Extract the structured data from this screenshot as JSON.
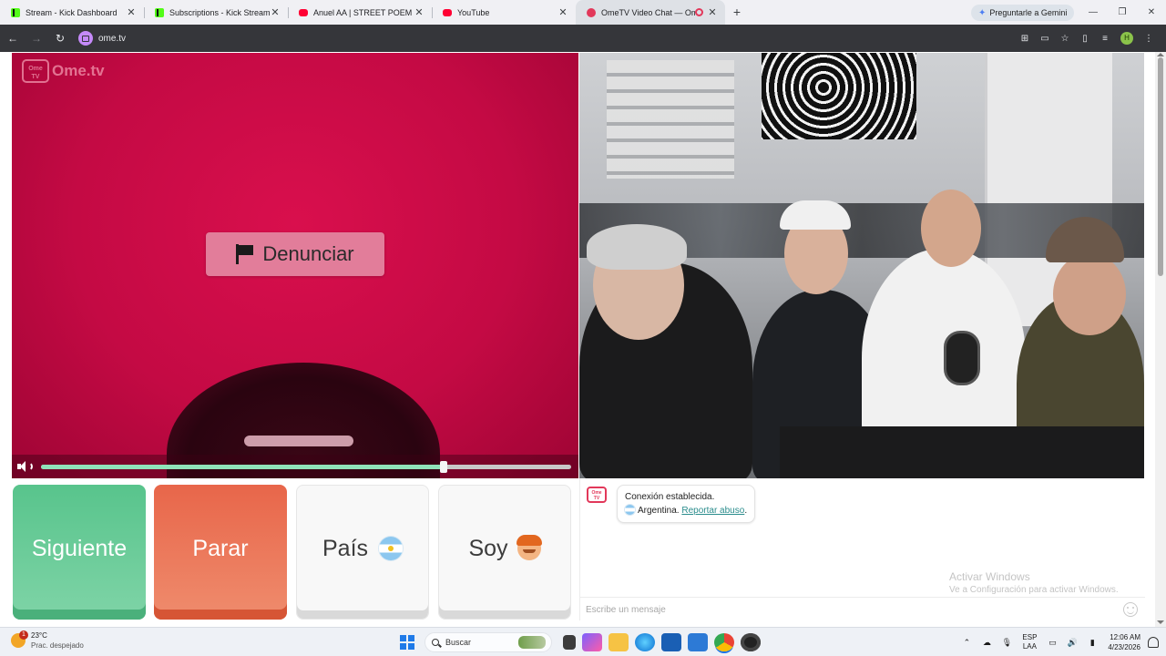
{
  "browser": {
    "tabs": [
      {
        "title": "Stream - Kick Dashboard",
        "favicon": "kick-icon"
      },
      {
        "title": "Subscriptions - Kick Streaming",
        "favicon": "kick-icon"
      },
      {
        "title": "Anuel AA | STREET POEM - You",
        "favicon": "youtube-icon"
      },
      {
        "title": "YouTube",
        "favicon": "youtube-icon"
      },
      {
        "title": "OmeTV Video Chat — Ome",
        "favicon": "ometv-icon",
        "active": true,
        "recording": true
      }
    ],
    "gemini_label": "Preguntarle a Gemini",
    "url": "ome.tv",
    "profile_initial": "H"
  },
  "app": {
    "logo_text": "Ome.tv",
    "logo_badge": "Ome TV",
    "report_button": "Denunciar",
    "volume_level": 0.76,
    "buttons": {
      "next": "Siguiente",
      "stop": "Parar",
      "country": "País",
      "gender": "Soy"
    },
    "chat": {
      "avatar_badge": "Ome TV",
      "status_line": "Conexión establecida.",
      "country_text": "Argentina.",
      "report_link": "Reportar abuso",
      "report_link_suffix": ".",
      "input_placeholder": "Escribe un mensaje"
    },
    "watermark": {
      "line1": "Activar Windows",
      "line2": "Ve a Configuración para activar Windows."
    }
  },
  "taskbar": {
    "weather_temp": "23°C",
    "weather_condition": "Prac. despejado",
    "weather_badge": "1",
    "search_placeholder": "Buscar",
    "lang_line1": "ESP",
    "lang_line2": "LAA",
    "time": "12:06 AM",
    "date": "4/23/2026"
  },
  "colors": {
    "next_button": "#58c48c",
    "stop_button": "#e8664a",
    "brand": "#e2385a",
    "volume_fill": "#8fe3b9"
  }
}
